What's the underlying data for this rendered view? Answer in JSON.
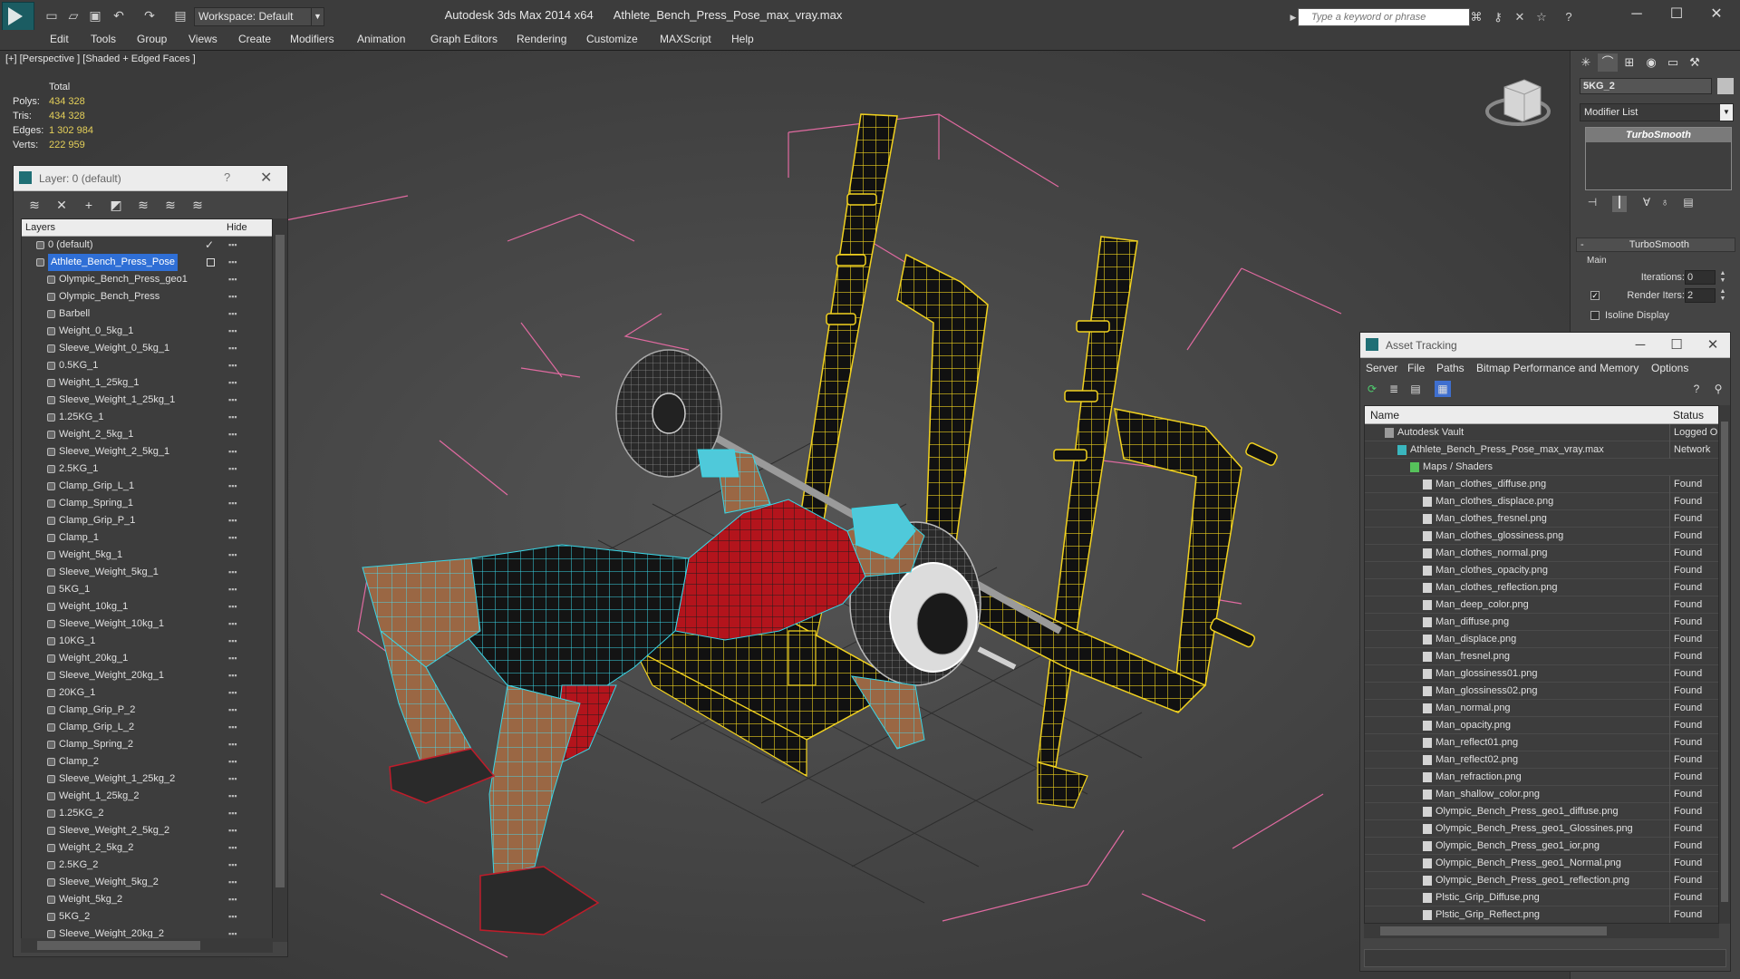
{
  "titlebar": {
    "workspace": "Workspace: Default",
    "app": "Autodesk 3ds Max  2014 x64",
    "file": "Athlete_Bench_Press_Pose_max_vray.max",
    "search_placeholder": "Type a keyword or phrase"
  },
  "menu": [
    "Edit",
    "Tools",
    "Group",
    "Views",
    "Create",
    "Modifiers",
    "Animation",
    "Graph Editors",
    "Rendering",
    "Customize",
    "MAXScript",
    "Help"
  ],
  "viewport": {
    "label": "[+] [Perspective ] [Shaded + Edged Faces ]",
    "stats": {
      "header": "Total",
      "polys_label": "Polys:",
      "polys": "434 328",
      "tris_label": "Tris:",
      "tris": "434 328",
      "edges_label": "Edges:",
      "edges": "1 302 984",
      "verts_label": "Verts:",
      "verts": "222 959"
    }
  },
  "layer_panel": {
    "title": "Layer: 0 (default)",
    "help": "?",
    "col_layers": "Layers",
    "col_hide": "Hide",
    "rows": [
      {
        "label": "0 (default)",
        "level": 1
      },
      {
        "label": "Athlete_Bench_Press_Pose",
        "level": 1,
        "selected": true
      },
      {
        "label": "Olympic_Bench_Press_geo1",
        "level": 2
      },
      {
        "label": "Olympic_Bench_Press",
        "level": 2
      },
      {
        "label": "Barbell",
        "level": 2
      },
      {
        "label": "Weight_0_5kg_1",
        "level": 2
      },
      {
        "label": "Sleeve_Weight_0_5kg_1",
        "level": 2
      },
      {
        "label": "0.5KG_1",
        "level": 2
      },
      {
        "label": "Weight_1_25kg_1",
        "level": 2
      },
      {
        "label": "Sleeve_Weight_1_25kg_1",
        "level": 2
      },
      {
        "label": "1.25KG_1",
        "level": 2
      },
      {
        "label": "Weight_2_5kg_1",
        "level": 2
      },
      {
        "label": "Sleeve_Weight_2_5kg_1",
        "level": 2
      },
      {
        "label": "2.5KG_1",
        "level": 2
      },
      {
        "label": "Clamp_Grip_L_1",
        "level": 2
      },
      {
        "label": "Clamp_Spring_1",
        "level": 2
      },
      {
        "label": "Clamp_Grip_P_1",
        "level": 2
      },
      {
        "label": "Clamp_1",
        "level": 2
      },
      {
        "label": "Weight_5kg_1",
        "level": 2
      },
      {
        "label": "Sleeve_Weight_5kg_1",
        "level": 2
      },
      {
        "label": "5KG_1",
        "level": 2
      },
      {
        "label": "Weight_10kg_1",
        "level": 2
      },
      {
        "label": "Sleeve_Weight_10kg_1",
        "level": 2
      },
      {
        "label": "10KG_1",
        "level": 2
      },
      {
        "label": "Weight_20kg_1",
        "level": 2
      },
      {
        "label": "Sleeve_Weight_20kg_1",
        "level": 2
      },
      {
        "label": "20KG_1",
        "level": 2
      },
      {
        "label": "Clamp_Grip_P_2",
        "level": 2
      },
      {
        "label": "Clamp_Grip_L_2",
        "level": 2
      },
      {
        "label": "Clamp_Spring_2",
        "level": 2
      },
      {
        "label": "Clamp_2",
        "level": 2
      },
      {
        "label": "Sleeve_Weight_1_25kg_2",
        "level": 2
      },
      {
        "label": "Weight_1_25kg_2",
        "level": 2
      },
      {
        "label": "1.25KG_2",
        "level": 2
      },
      {
        "label": "Sleeve_Weight_2_5kg_2",
        "level": 2
      },
      {
        "label": "Weight_2_5kg_2",
        "level": 2
      },
      {
        "label": "2.5KG_2",
        "level": 2
      },
      {
        "label": "Sleeve_Weight_5kg_2",
        "level": 2
      },
      {
        "label": "Weight_5kg_2",
        "level": 2
      },
      {
        "label": "5KG_2",
        "level": 2
      },
      {
        "label": "Sleeve_Weight_20kg_2",
        "level": 2
      }
    ]
  },
  "command_panel": {
    "object_name": "5KG_2",
    "modifier_list": "Modifier List",
    "stack_item": "TurboSmooth",
    "rollout_title": "TurboSmooth",
    "group_main": "Main",
    "iterations_label": "Iterations:",
    "iterations_value": "0",
    "render_iters_label": "Render Iters:",
    "render_iters_value": "2",
    "isoline_label": "Isoline Display"
  },
  "asset_tracking": {
    "title": "Asset Tracking",
    "menu": [
      "Server",
      "File",
      "Paths",
      "Bitmap Performance and Memory",
      "Options"
    ],
    "col_name": "Name",
    "col_status": "Status",
    "rows": [
      {
        "name": "Autodesk Vault",
        "status": "Logged Out",
        "level": 0,
        "kind": "vault"
      },
      {
        "name": "Athlete_Bench_Press_Pose_max_vray.max",
        "status": "Network",
        "level": 1,
        "kind": "max"
      },
      {
        "name": "Maps / Shaders",
        "status": "",
        "level": 2,
        "kind": "folder"
      },
      {
        "name": "Man_clothes_diffuse.png",
        "status": "Found",
        "level": 3,
        "kind": "file"
      },
      {
        "name": "Man_clothes_displace.png",
        "status": "Found",
        "level": 3,
        "kind": "file"
      },
      {
        "name": "Man_clothes_fresnel.png",
        "status": "Found",
        "level": 3,
        "kind": "file"
      },
      {
        "name": "Man_clothes_glossiness.png",
        "status": "Found",
        "level": 3,
        "kind": "file"
      },
      {
        "name": "Man_clothes_normal.png",
        "status": "Found",
        "level": 3,
        "kind": "file"
      },
      {
        "name": "Man_clothes_opacity.png",
        "status": "Found",
        "level": 3,
        "kind": "file"
      },
      {
        "name": "Man_clothes_reflection.png",
        "status": "Found",
        "level": 3,
        "kind": "file"
      },
      {
        "name": "Man_deep_color.png",
        "status": "Found",
        "level": 3,
        "kind": "file"
      },
      {
        "name": "Man_diffuse.png",
        "status": "Found",
        "level": 3,
        "kind": "file"
      },
      {
        "name": "Man_displace.png",
        "status": "Found",
        "level": 3,
        "kind": "file"
      },
      {
        "name": "Man_fresnel.png",
        "status": "Found",
        "level": 3,
        "kind": "file"
      },
      {
        "name": "Man_glossiness01.png",
        "status": "Found",
        "level": 3,
        "kind": "file"
      },
      {
        "name": "Man_glossiness02.png",
        "status": "Found",
        "level": 3,
        "kind": "file"
      },
      {
        "name": "Man_normal.png",
        "status": "Found",
        "level": 3,
        "kind": "file"
      },
      {
        "name": "Man_opacity.png",
        "status": "Found",
        "level": 3,
        "kind": "file"
      },
      {
        "name": "Man_reflect01.png",
        "status": "Found",
        "level": 3,
        "kind": "file"
      },
      {
        "name": "Man_reflect02.png",
        "status": "Found",
        "level": 3,
        "kind": "file"
      },
      {
        "name": "Man_refraction.png",
        "status": "Found",
        "level": 3,
        "kind": "file"
      },
      {
        "name": "Man_shallow_color.png",
        "status": "Found",
        "level": 3,
        "kind": "file"
      },
      {
        "name": "Olympic_Bench_Press_geo1_diffuse.png",
        "status": "Found",
        "level": 3,
        "kind": "file"
      },
      {
        "name": "Olympic_Bench_Press_geo1_Glossines.png",
        "status": "Found",
        "level": 3,
        "kind": "file"
      },
      {
        "name": "Olympic_Bench_Press_geo1_ior.png",
        "status": "Found",
        "level": 3,
        "kind": "file"
      },
      {
        "name": "Olympic_Bench_Press_geo1_Normal.png",
        "status": "Found",
        "level": 3,
        "kind": "file"
      },
      {
        "name": "Olympic_Bench_Press_geo1_reflection.png",
        "status": "Found",
        "level": 3,
        "kind": "file"
      },
      {
        "name": "Plstic_Grip_Diffuse.png",
        "status": "Found",
        "level": 3,
        "kind": "file"
      },
      {
        "name": "Plstic_Grip_Reflect.png",
        "status": "Found",
        "level": 3,
        "kind": "file"
      }
    ]
  },
  "colors": {
    "wire_yellow": "#f2d21f",
    "wire_cyan": "#3ad6e6",
    "wire_pink": "#e06aa0",
    "cloth_red": "#b3141c",
    "skin": "#9a6744",
    "selection_blue": "#2f6fd6"
  }
}
